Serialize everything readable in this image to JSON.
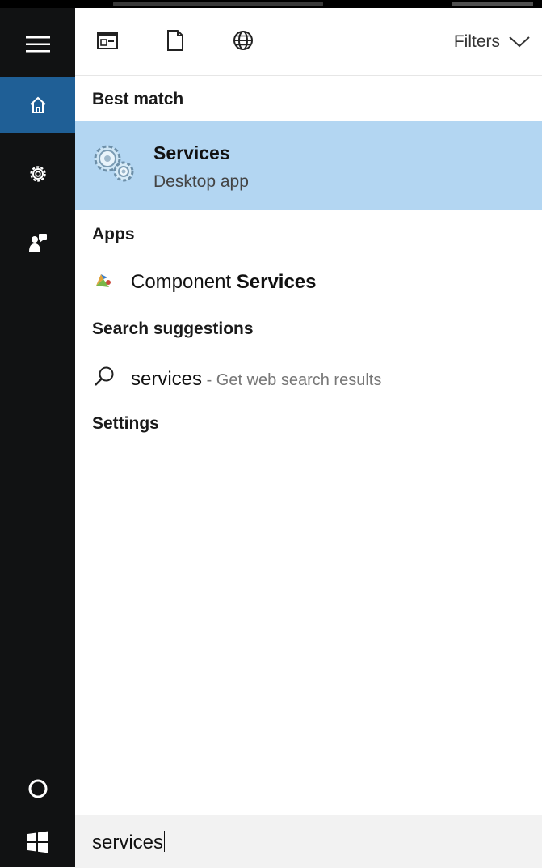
{
  "toolbar": {
    "filters_label": "Filters",
    "icons": [
      "apps-icon",
      "documents-icon",
      "web-icon",
      "chevron-down-icon"
    ]
  },
  "rail": {
    "icons": [
      "hamburger-icon",
      "home-icon",
      "settings-icon",
      "feedback-icon",
      "cortana-icon",
      "windows-start-icon"
    ],
    "active": "home"
  },
  "sections": {
    "best_match": "Best match",
    "apps": "Apps",
    "search_suggestions": "Search suggestions",
    "settings": "Settings"
  },
  "best_match": {
    "title": "Services",
    "subtitle": "Desktop app"
  },
  "apps": [
    {
      "label_prefix": "Component ",
      "label_bold": "Services"
    }
  ],
  "suggestions": [
    {
      "query": "services",
      "hint": " - Get web search results"
    }
  ],
  "search": {
    "value": "services"
  },
  "colors": {
    "rail_bg": "#111213",
    "rail_active": "#1f5f96",
    "highlight": "#b3d6f2",
    "search_bg": "#f2f2f2"
  }
}
